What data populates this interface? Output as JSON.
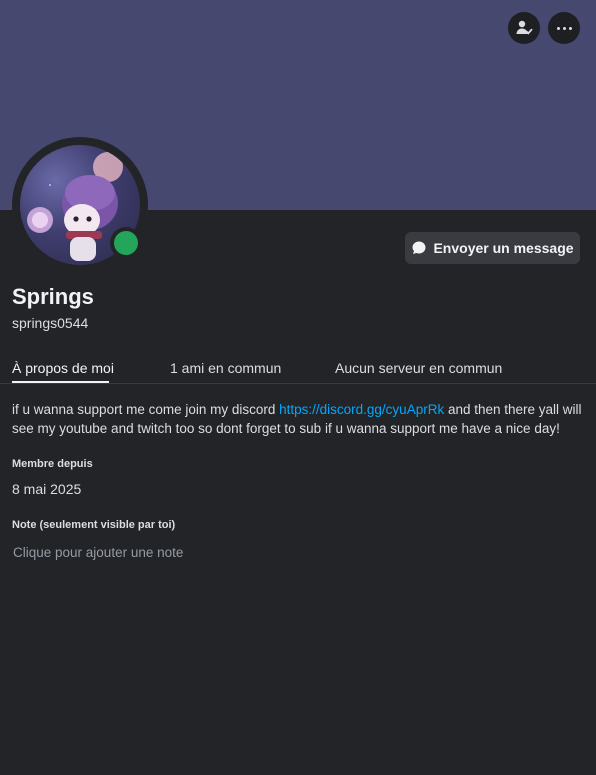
{
  "profile": {
    "display_name": "Springs",
    "username": "springs0544",
    "status": "online",
    "banner_color": "#474870",
    "status_color": "#23a55a"
  },
  "actions": {
    "send_message": "Envoyer un message",
    "friend_icon": "add-friend-icon",
    "more_icon": "more-options-icon"
  },
  "tabs": [
    {
      "label": "À propos de moi",
      "active": true
    },
    {
      "label": "1 ami en commun",
      "active": false
    },
    {
      "label": "Aucun serveur en commun",
      "active": false
    }
  ],
  "bio": {
    "before_link": "if u wanna support me come join my discord ",
    "link": "https://discord.gg/cyuAprRk",
    "after_link": "  and then there yall will see my youtube and twitch too so dont forget to sub if u wanna support me have a nice day!"
  },
  "member_since": {
    "label": "Membre depuis",
    "value": "8 mai 2025"
  },
  "note": {
    "label": "Note (seulement visible par toi)",
    "placeholder": "Clique pour ajouter une note"
  }
}
